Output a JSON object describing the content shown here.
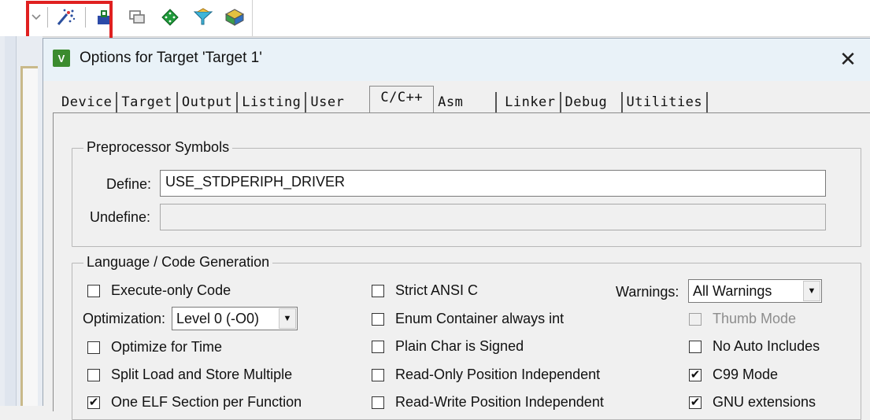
{
  "dialog": {
    "title": "Options for Target 'Target 1'",
    "app_icon_glyph": "V",
    "close_glyph": "✕"
  },
  "tabs": [
    {
      "label": "Device"
    },
    {
      "label": "Target"
    },
    {
      "label": "Output"
    },
    {
      "label": "Listing"
    },
    {
      "label": "User"
    },
    {
      "label": "C/C++"
    },
    {
      "label": "Asm"
    },
    {
      "label": "Linker"
    },
    {
      "label": "Debug"
    },
    {
      "label": "Utilities"
    }
  ],
  "active_tab": "C/C++",
  "preprocessor": {
    "title": "Preprocessor Symbols",
    "define_label": "Define:",
    "define_value": "USE_STDPERIPH_DRIVER",
    "undefine_label": "Undefine:",
    "undefine_value": ""
  },
  "language": {
    "title": "Language / Code Generation",
    "execute_only": {
      "label": "Execute-only Code",
      "checked": false
    },
    "optimization_label": "Optimization:",
    "optimization_value": "Level 0 (-O0)",
    "optimize_time": {
      "label": "Optimize for Time",
      "checked": false
    },
    "split_load": {
      "label": "Split Load and Store Multiple",
      "checked": false
    },
    "one_elf": {
      "label": "One ELF Section per Function",
      "checked": true
    },
    "strict_ansi": {
      "label": "Strict ANSI C",
      "checked": false
    },
    "enum_container": {
      "label": "Enum Container always int",
      "checked": false
    },
    "plain_char": {
      "label": "Plain Char is Signed",
      "checked": false
    },
    "ro_pi": {
      "label": "Read-Only Position Independent",
      "checked": false
    },
    "rw_pi": {
      "label": "Read-Write Position Independent",
      "checked": false
    },
    "warnings_label": "Warnings:",
    "warnings_value": "All Warnings",
    "thumb_mode": {
      "label": "Thumb Mode",
      "checked": false
    },
    "no_auto_includes": {
      "label": "No Auto Includes",
      "checked": false
    },
    "c99_mode": {
      "label": "C99 Mode",
      "checked": true
    },
    "gnu_extensions": {
      "label": "GNU extensions",
      "checked": true
    }
  },
  "colors": {
    "highlight": "#e02020",
    "titlebar": "#e9f2f8"
  },
  "icons": [
    "dropdown-arrow-icon",
    "magic-wand-icon",
    "load-icon",
    "copy-icon",
    "diamond-icon",
    "funnel-icon",
    "packs-icon"
  ]
}
